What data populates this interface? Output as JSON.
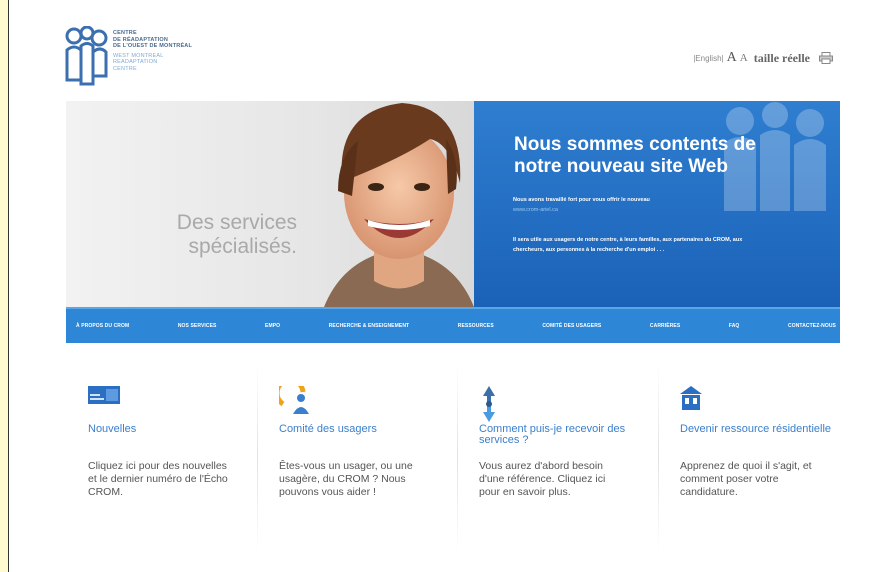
{
  "header": {
    "logo_fr": [
      "CENTRE",
      "DE RÉADAPTATION",
      "DE L'OUEST DE MONTRÉAL"
    ],
    "logo_en": [
      "WEST MONTREAL",
      "READAPTATION",
      "CENTRE"
    ],
    "lang_link": "|English| ",
    "font_large": "A",
    "font_small": "A",
    "real_size": "taille réelle",
    "print_icon": "printer-icon"
  },
  "hero": {
    "tagline": "Des services spécialisés.",
    "title": "Nous sommes contents de notre nouveau site Web",
    "intro": "Nous avons travaillé fort pour vous offrir le nouveau",
    "link": "www.crom-ariel.ca",
    "body": "Il sera utile aux usagers de notre centre, à leurs familles, aux partenaires du CROM, aux chercheurs, aux personnes à la recherche d'un emploi . . ."
  },
  "nav": {
    "items": [
      "À PROPOS DU CROM",
      "NOS SERVICES",
      "EMPO",
      "RECHERCHE & ENSEIGNEMENT",
      "RESSOURCES",
      "COMITÉ DES USAGERS",
      "CARRIÈRES",
      "FAQ",
      "CONTACTEZ-NOUS"
    ]
  },
  "cards": [
    {
      "icon": "newspaper-icon",
      "title": "Nouvelles",
      "text": "Cliquez ici pour des nouvelles et le dernier numéro de l'Écho CROM."
    },
    {
      "icon": "users-committee-icon",
      "title": "Comité des usagers",
      "text": "Êtes-vous un usager, ou une usagère, du CROM ? Nous pouvons vous aider !"
    },
    {
      "icon": "question-arrows-icon",
      "title": "Comment puis-je recevoir des services ?",
      "text": "Vous aurez d'abord besoin d'une référence. Cliquez ici pour en savoir plus."
    },
    {
      "icon": "house-icon",
      "title": "Devenir ressource résidentielle",
      "text": "Apprenez de quoi il s'agit, et comment poser votre candidature."
    }
  ],
  "colors": {
    "accent": "#2e86d6",
    "card_title": "#3b7fcc",
    "page_bg": "#fffbd0"
  }
}
